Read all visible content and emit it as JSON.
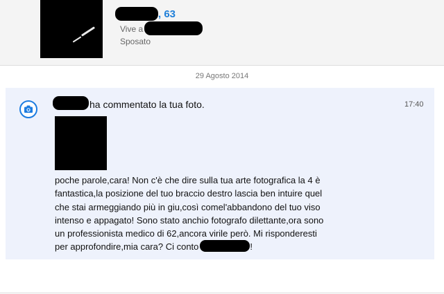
{
  "profile": {
    "age_suffix": ", 63",
    "lives_prefix": "Vive a",
    "status": "Sposato"
  },
  "date_separator": "29 Agosto 2014",
  "notification": {
    "action_text": "ha commentato la tua foto.",
    "time": "17:40",
    "comment_lines": [
      "poche parole,cara! Non c'è che dire sulla tua arte fotografica la 4 è",
      "fantastica,la posizione del tuo braccio destro lascia ben intuire quel",
      "che stai armeggiando più in giu,così comel'abbandono del tuo viso",
      "intenso e appagato! Sono stato anchio fotografo dilettante,ora sono",
      "un professionista medico di 62,ancora virile però. Mi risponderesti",
      "per approfondire,mia cara? Ci conto"
    ],
    "comment_end": "!"
  },
  "colors": {
    "accent": "#1f7fd8",
    "notification_bg": "#eef2fc"
  },
  "icons": {
    "notification_icon": "camera-icon"
  }
}
